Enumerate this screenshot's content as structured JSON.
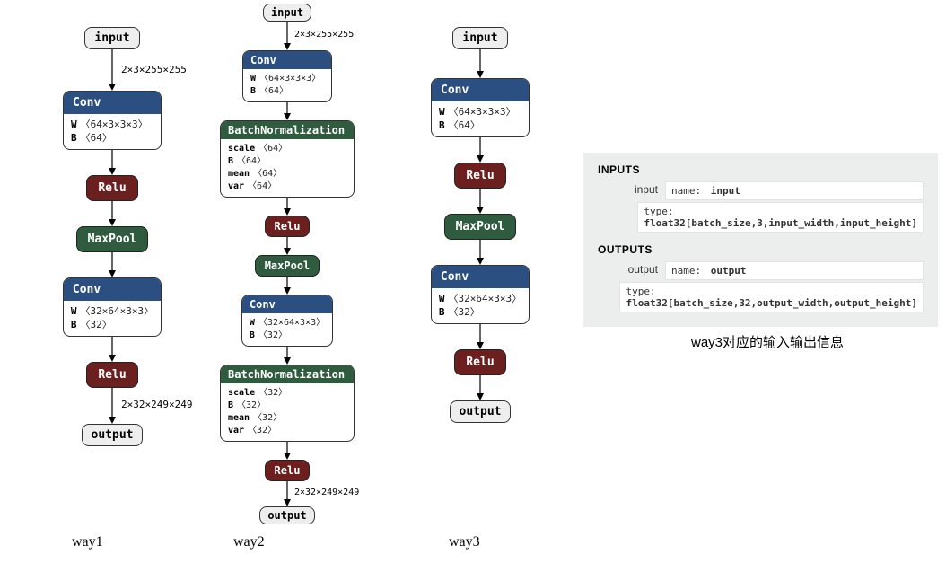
{
  "way1": {
    "label": "way1",
    "input": "input",
    "edge_in": "2×3×255×255",
    "conv1": {
      "title": "Conv",
      "W": "〈64×3×3×3〉",
      "B": "〈64〉"
    },
    "relu1": "Relu",
    "maxpool": "MaxPool",
    "conv2": {
      "title": "Conv",
      "W": "〈32×64×3×3〉",
      "B": "〈32〉"
    },
    "relu2": "Relu",
    "edge_out": "2×32×249×249",
    "output": "output"
  },
  "way2": {
    "label": "way2",
    "input": "input",
    "edge_in": "2×3×255×255",
    "conv1": {
      "title": "Conv",
      "W": "〈64×3×3×3〉",
      "B": "〈64〉"
    },
    "bn1": {
      "title": "BatchNormalization",
      "scale": "〈64〉",
      "B": "〈64〉",
      "mean": "〈64〉",
      "var": "〈64〉"
    },
    "relu1": "Relu",
    "maxpool": "MaxPool",
    "conv2": {
      "title": "Conv",
      "W": "〈32×64×3×3〉",
      "B": "〈32〉"
    },
    "bn2": {
      "title": "BatchNormalization",
      "scale": "〈32〉",
      "B": "〈32〉",
      "mean": "〈32〉",
      "var": "〈32〉"
    },
    "relu2": "Relu",
    "edge_out": "2×32×249×249",
    "output": "output"
  },
  "way3": {
    "label": "way3",
    "input": "input",
    "conv1": {
      "title": "Conv",
      "W": "〈64×3×3×3〉",
      "B": "〈64〉"
    },
    "relu1": "Relu",
    "maxpool": "MaxPool",
    "conv2": {
      "title": "Conv",
      "W": "〈32×64×3×3〉",
      "B": "〈32〉"
    },
    "relu2": "Relu",
    "output": "output"
  },
  "panel": {
    "inputs_title": "INPUTS",
    "outputs_title": "OUTPUTS",
    "input_key": "input",
    "output_key": "output",
    "name_label": "name:",
    "type_label": "type:",
    "input_name": "input",
    "input_type": "float32[batch_size,3,input_width,input_height]",
    "output_name": "output",
    "output_type": "float32[batch_size,32,output_width,output_height]"
  },
  "info_caption": "way3对应的输入输出信息"
}
